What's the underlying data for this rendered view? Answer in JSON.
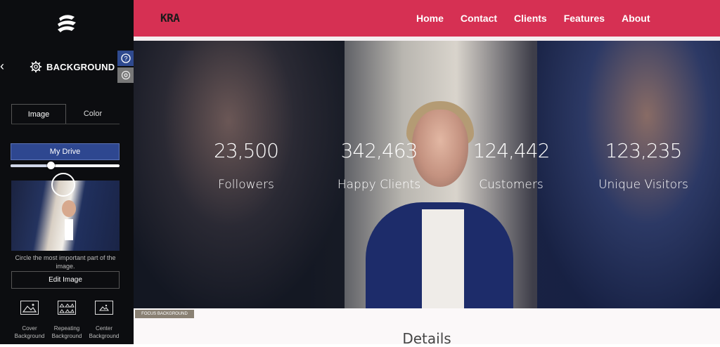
{
  "sidebar": {
    "back_icon": "chevron-left-icon",
    "panel_title": "BACKGROUND",
    "panel_icon": "gear-icon",
    "tabs": [
      "Image",
      "Color"
    ],
    "active_tab": "Image",
    "drive_button": "My Drive",
    "slider_value": 0.37,
    "hint": "Circle the most important part of the image.",
    "edit_button": "Edit Image",
    "bg_options": [
      {
        "label": "Cover Background",
        "icon": "cover-background-icon"
      },
      {
        "label": "Repeating Background",
        "icon": "repeating-background-icon"
      },
      {
        "label": "Center Background",
        "icon": "center-background-icon"
      }
    ],
    "side_buttons": [
      "help-icon",
      "focus-icon"
    ]
  },
  "site": {
    "brand": "KRA",
    "nav": [
      "Home",
      "Contact",
      "Clients",
      "Features",
      "About"
    ],
    "accent": "#d63053"
  },
  "stats": [
    {
      "number": "23,500",
      "label": "Followers"
    },
    {
      "number": "342,463",
      "label": "Happy Clients"
    },
    {
      "number": "124,442",
      "label": "Customers"
    },
    {
      "number": "123,235",
      "label": "Unique Visitors"
    }
  ],
  "focus_tag": "FOCUS BACKGROUND",
  "details_heading": "Details"
}
